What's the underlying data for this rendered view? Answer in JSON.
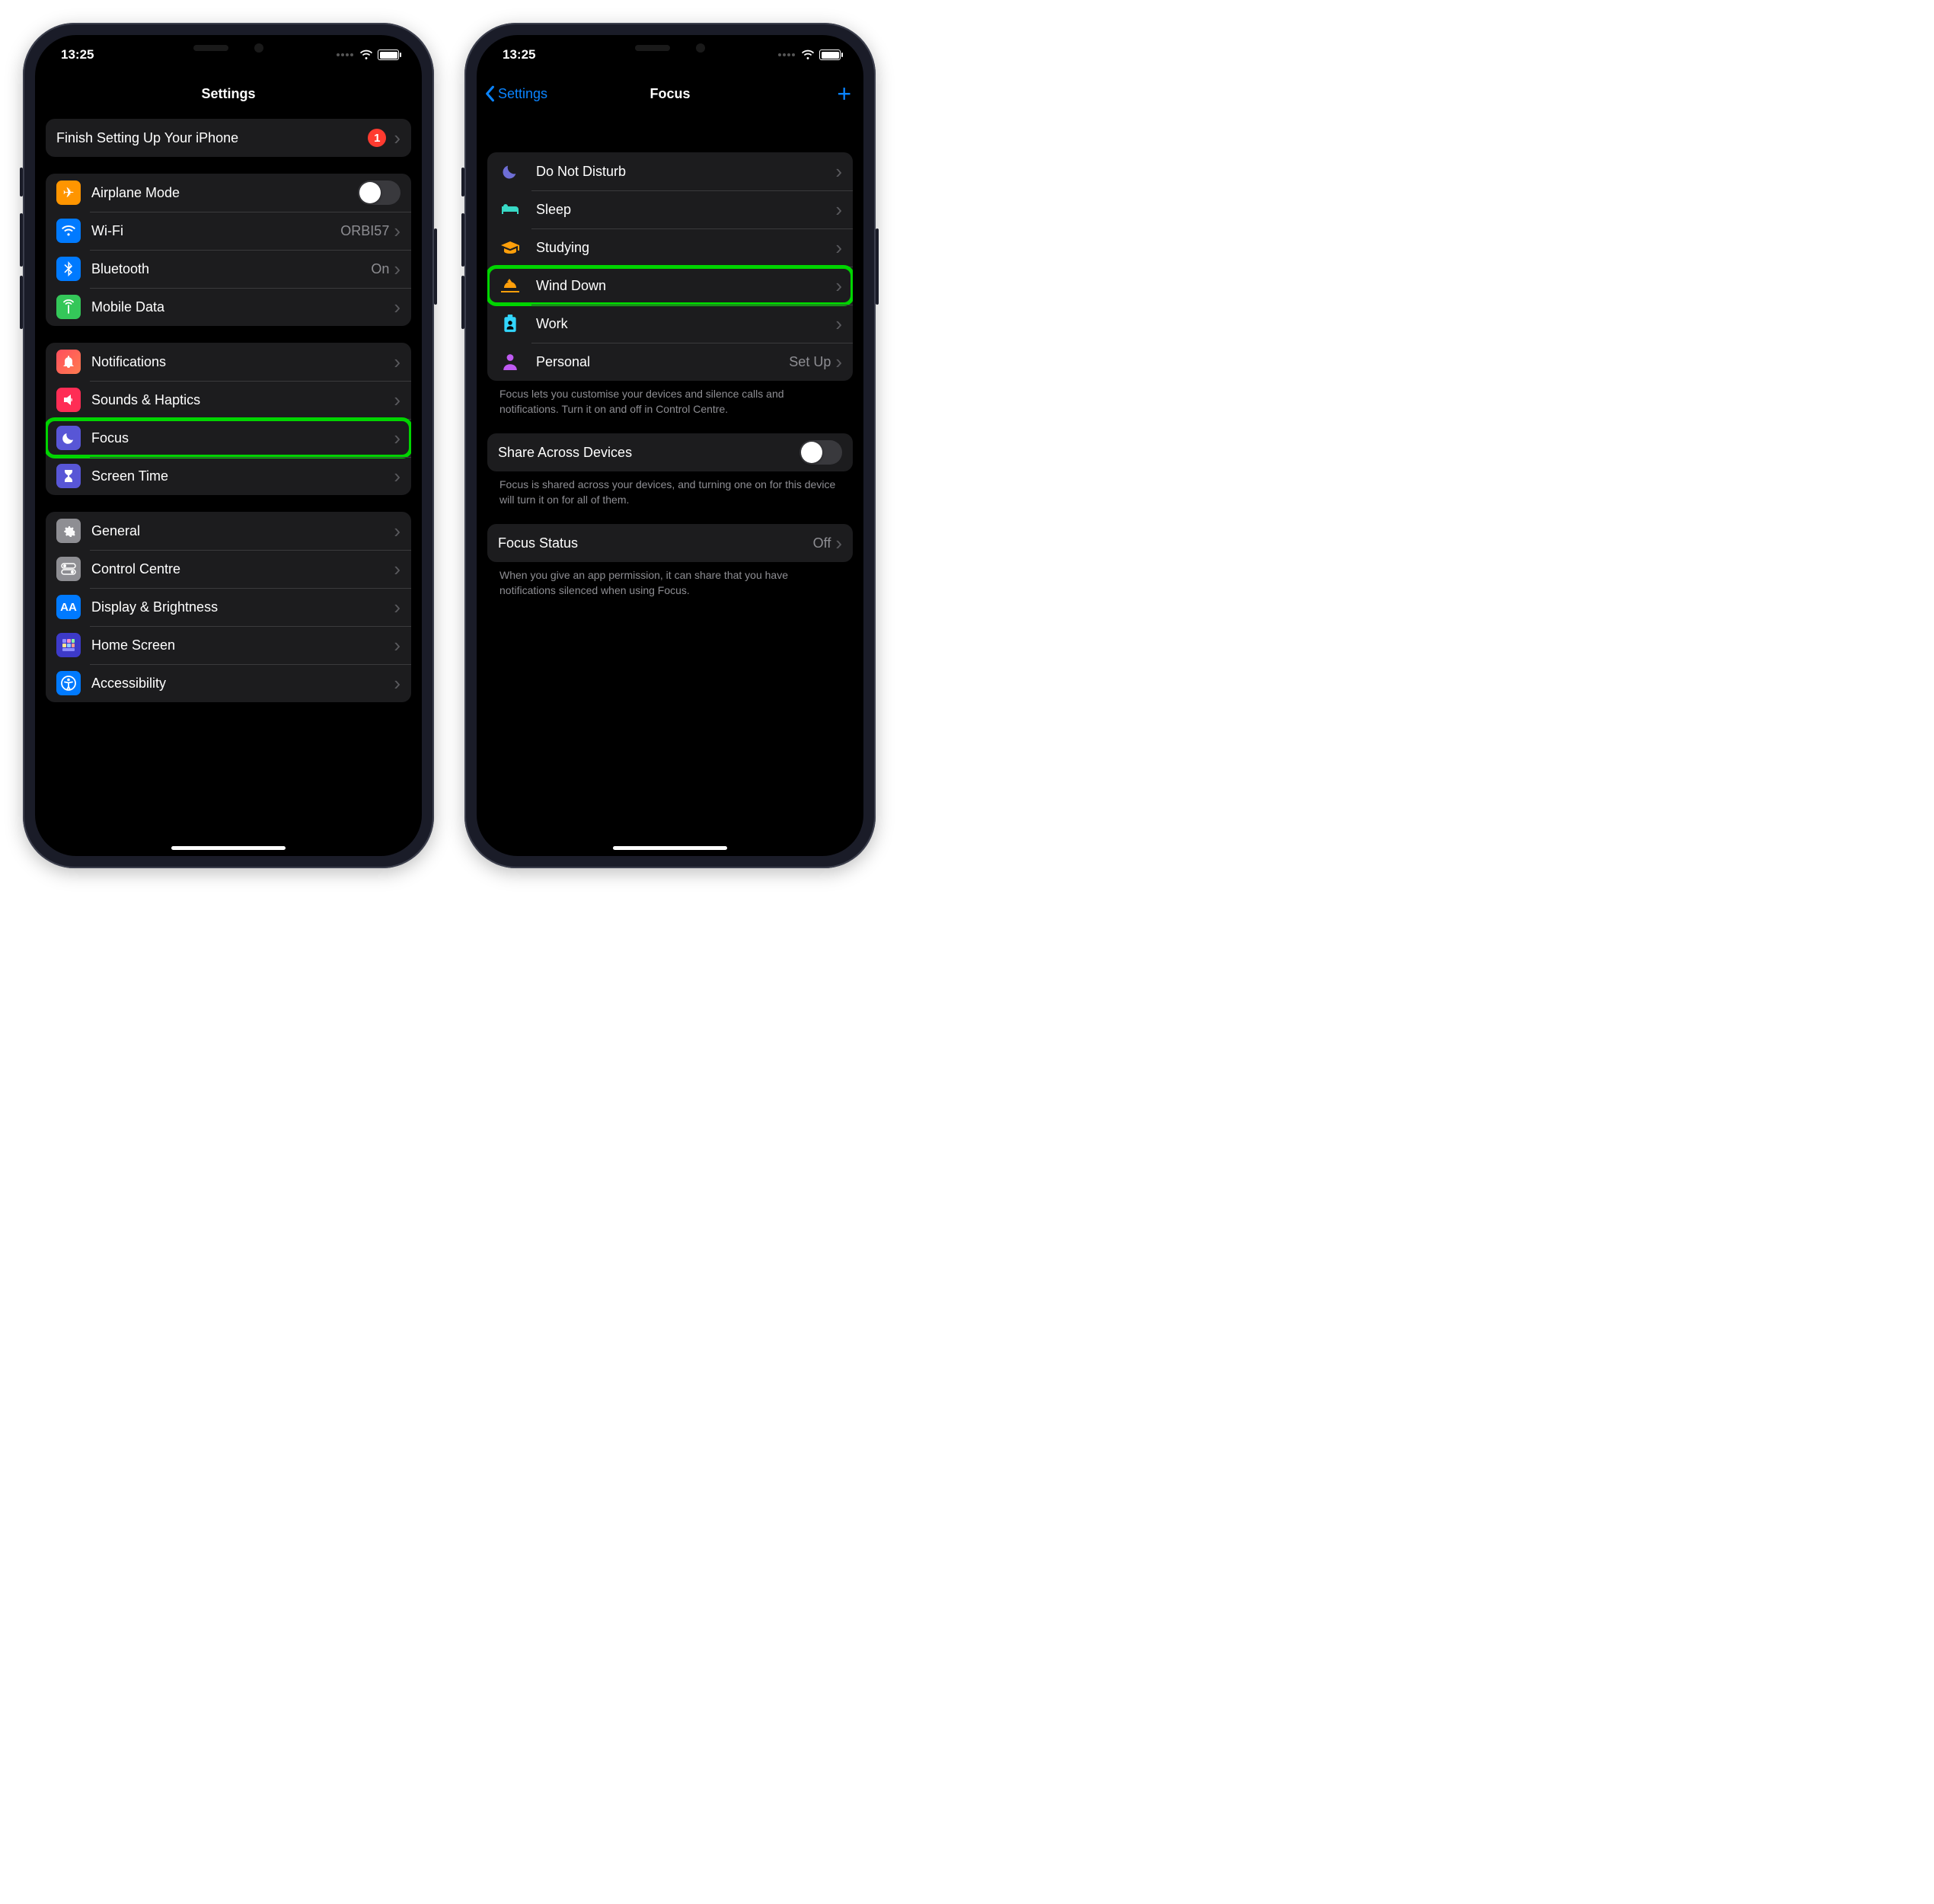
{
  "statusTime": "13:25",
  "left": {
    "title": "Settings",
    "finishRow": {
      "label": "Finish Setting Up Your iPhone",
      "badge": "1"
    },
    "group1": {
      "airplane": "Airplane Mode",
      "wifi": "Wi-Fi",
      "wifiValue": "ORBI57",
      "bluetooth": "Bluetooth",
      "bluetoothValue": "On",
      "mobileData": "Mobile Data"
    },
    "group2": {
      "notifications": "Notifications",
      "sounds": "Sounds & Haptics",
      "focus": "Focus",
      "screenTime": "Screen Time"
    },
    "group3": {
      "general": "General",
      "controlCentre": "Control Centre",
      "display": "Display & Brightness",
      "homeScreen": "Home Screen",
      "accessibility": "Accessibility"
    }
  },
  "right": {
    "title": "Focus",
    "back": "Settings",
    "modes": {
      "dnd": "Do Not Disturb",
      "sleep": "Sleep",
      "studying": "Studying",
      "windDown": "Wind Down",
      "work": "Work",
      "personal": "Personal",
      "personalValue": "Set Up"
    },
    "footer1": "Focus lets you customise your devices and silence calls and notifications. Turn it on and off in Control Centre.",
    "share": {
      "label": "Share Across Devices"
    },
    "footer2": "Focus is shared across your devices, and turning one on for this device will turn it on for all of them.",
    "status": {
      "label": "Focus Status",
      "value": "Off"
    },
    "footer3": "When you give an app permission, it can share that you have notifications silenced when using Focus."
  }
}
